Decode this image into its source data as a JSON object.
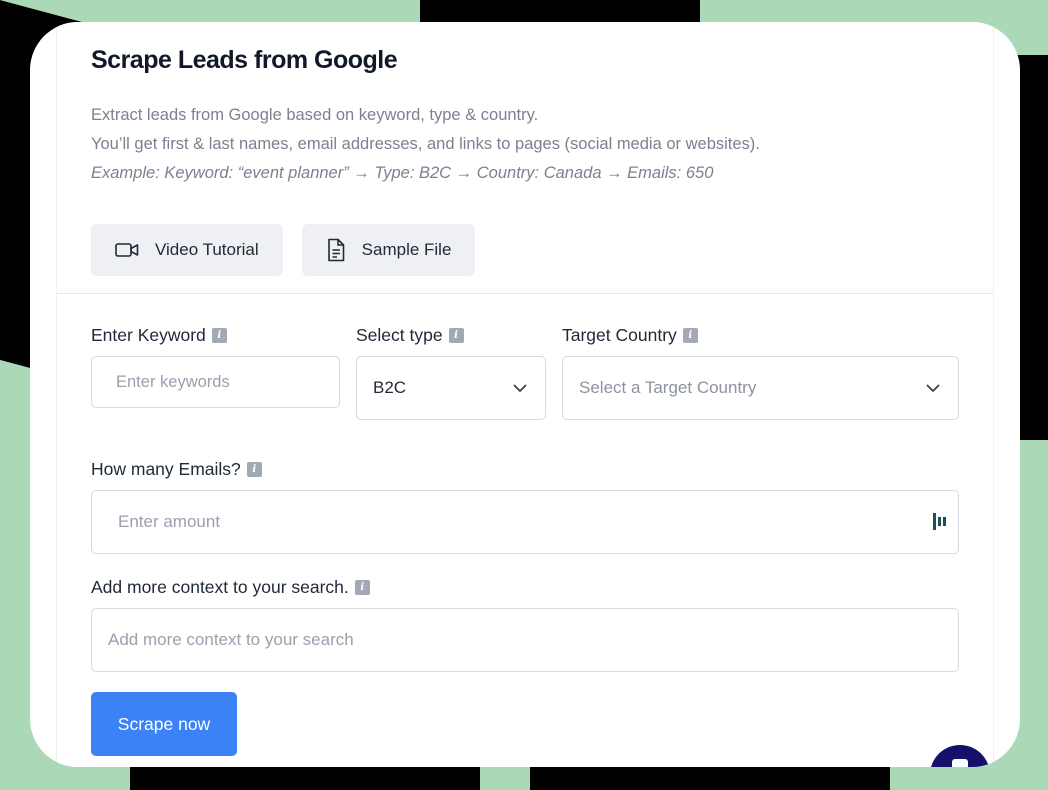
{
  "header": {
    "title": "Scrape Leads from Google",
    "description_line1": "Extract leads from Google based on keyword, type & country.",
    "description_line2": "You’ll get first & last names, email addresses, and links to pages (social media or websites).",
    "example": "Example: Keyword: “event planner” → Type: B2C → Country: Canada → Emails: 650"
  },
  "buttons": {
    "video_tutorial": "Video Tutorial",
    "sample_file": "Sample File",
    "scrape_now": "Scrape now"
  },
  "form": {
    "keyword": {
      "label": "Enter Keyword",
      "placeholder": "Enter keywords"
    },
    "type": {
      "label": "Select type",
      "value": "B2C"
    },
    "country": {
      "label": "Target Country",
      "placeholder": "Select a Target Country"
    },
    "emails": {
      "label": "How many Emails?",
      "placeholder": "Enter amount"
    },
    "context": {
      "label": "Add more context to your search.",
      "placeholder": "Add more context to your search"
    }
  },
  "icons": {
    "info": "i",
    "video": "video-camera-icon",
    "file": "document-icon",
    "chevron": "chevron-down-icon",
    "chat": "chat-widget-icon"
  },
  "colors": {
    "primary": "#3b82f6",
    "background_green": "#abd9b7",
    "chat_widget": "#15116b"
  }
}
